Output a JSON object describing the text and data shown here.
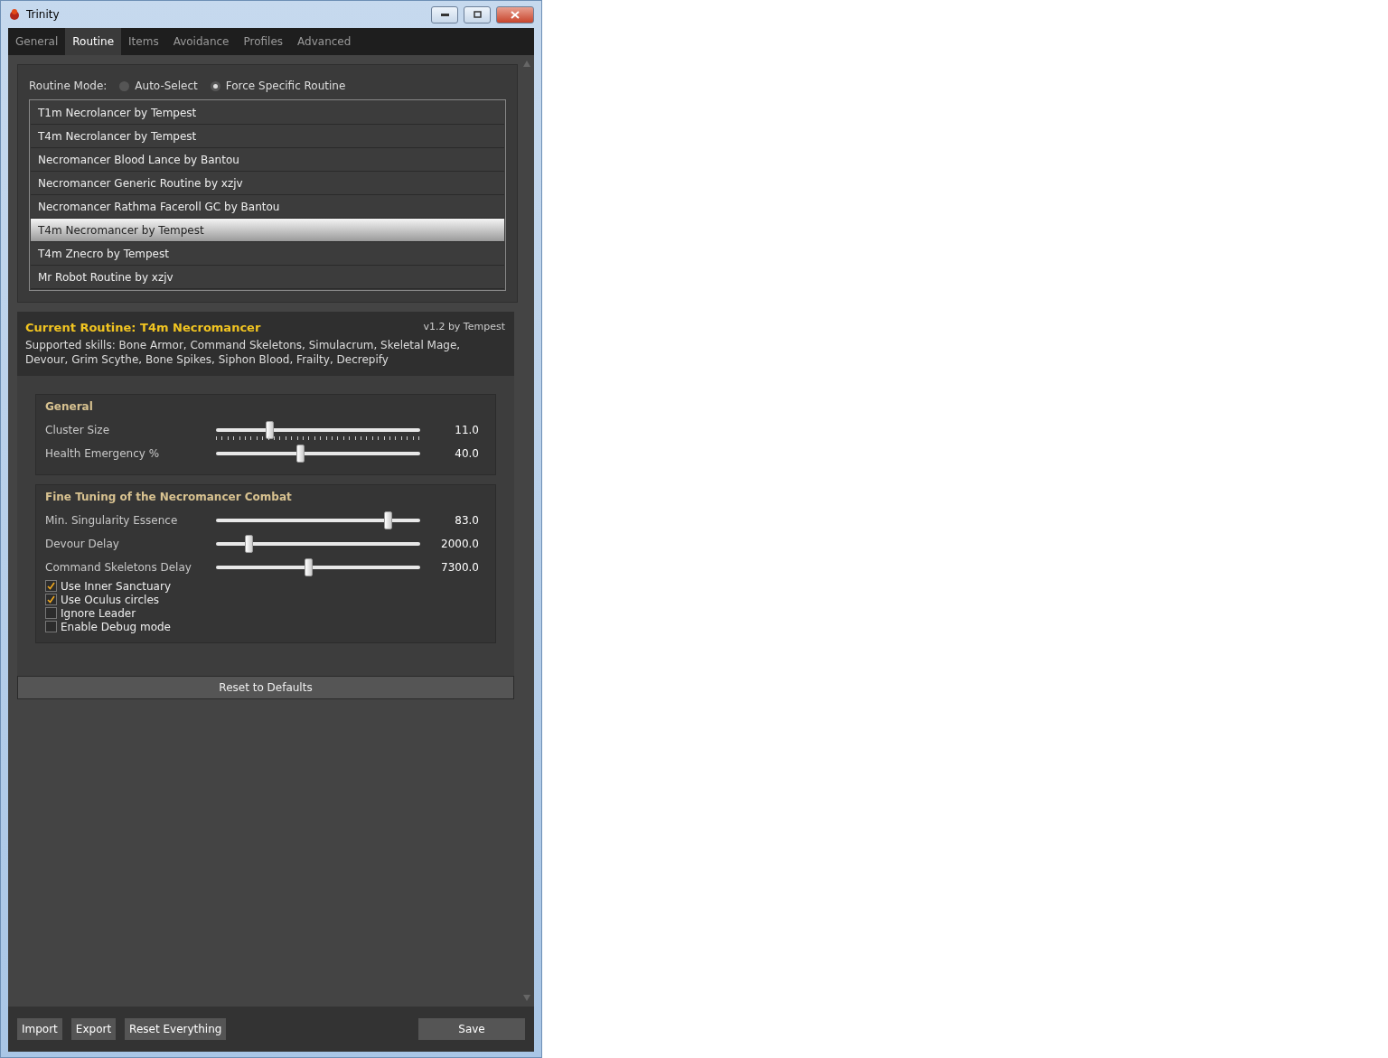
{
  "window": {
    "title": "Trinity"
  },
  "tabs": [
    {
      "label": "General",
      "selected": false
    },
    {
      "label": "Routine",
      "selected": true
    },
    {
      "label": "Items",
      "selected": false
    },
    {
      "label": "Avoidance",
      "selected": false
    },
    {
      "label": "Profiles",
      "selected": false
    },
    {
      "label": "Advanced",
      "selected": false
    }
  ],
  "routine_mode": {
    "label": "Routine Mode:",
    "options": [
      {
        "label": "Auto-Select",
        "selected": false
      },
      {
        "label": "Force Specific Routine",
        "selected": true
      }
    ]
  },
  "routines": [
    {
      "label": "T1m Necrolancer by Tempest",
      "selected": false
    },
    {
      "label": "T4m Necrolancer by Tempest",
      "selected": false
    },
    {
      "label": "Necromancer Blood Lance by Bantou",
      "selected": false
    },
    {
      "label": "Necromancer Generic Routine by xzjv",
      "selected": false
    },
    {
      "label": "Necromancer Rathma Faceroll GC by Bantou",
      "selected": false
    },
    {
      "label": "T4m Necromancer by Tempest",
      "selected": true
    },
    {
      "label": "T4m Znecro by Tempest",
      "selected": false
    },
    {
      "label": "Mr Robot Routine by xzjv",
      "selected": false
    }
  ],
  "current": {
    "title": "Current Routine: T4m Necromancer",
    "version": "v1.2 by Tempest",
    "description": "Supported skills: Bone Armor, Command Skeletons, Simulacrum, Skeletal Mage, Devour, Grim Scythe, Bone Spikes, Siphon Blood, Frailty, Decrepify"
  },
  "groups": [
    {
      "title": "General",
      "items": [
        {
          "kind": "slider",
          "label": "Cluster Size",
          "level": 0.26,
          "reading": "11.0",
          "ticks": true
        },
        {
          "kind": "slider",
          "label": "Health Emergency %",
          "level": 0.41,
          "reading": "40.0",
          "ticks": false
        }
      ]
    },
    {
      "title": "Fine Tuning of the Necromancer Combat",
      "items": [
        {
          "kind": "slider",
          "label": "Min. Singularity Essence",
          "level": 0.84,
          "reading": "83.0",
          "ticks": false
        },
        {
          "kind": "slider",
          "label": "Devour Delay",
          "level": 0.16,
          "reading": "2000.0",
          "ticks": false
        },
        {
          "kind": "slider",
          "label": "Command Skeletons Delay",
          "level": 0.45,
          "reading": "7300.0",
          "ticks": false
        },
        {
          "kind": "checkbox",
          "label": "Use Inner Sanctuary",
          "checked": true
        },
        {
          "kind": "checkbox",
          "label": "Use Oculus circles",
          "checked": true
        },
        {
          "kind": "checkbox",
          "label": "Ignore Leader",
          "checked": false
        },
        {
          "kind": "checkbox",
          "label": "Enable Debug mode",
          "checked": false
        }
      ]
    }
  ],
  "reset_button": "Reset to Defaults",
  "footer": {
    "left_buttons": [
      "Import",
      "Export",
      "Reset Everything"
    ],
    "save_button": "Save"
  }
}
